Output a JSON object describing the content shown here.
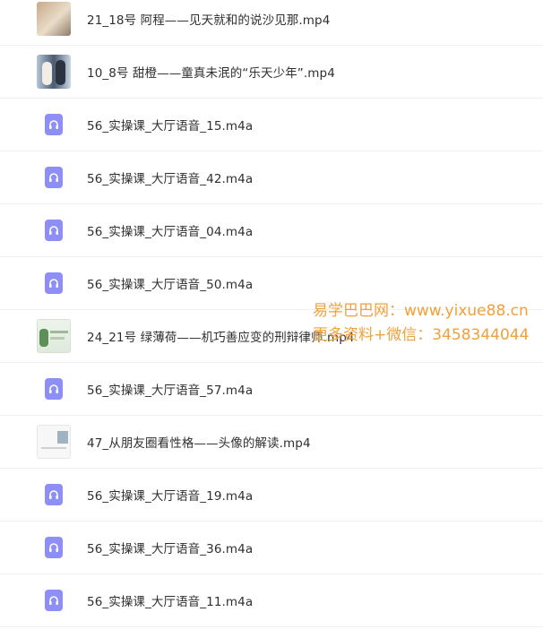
{
  "files": [
    {
      "name": "21_18号 阿程——见天就和的说沙见那.mp4",
      "kind": "video",
      "thumb": "a"
    },
    {
      "name": "10_8号 甜橙——童真未泯的“乐天少年”.mp4",
      "kind": "video",
      "thumb": "b"
    },
    {
      "name": "56_实操课_大厅语音_15.m4a",
      "kind": "audio"
    },
    {
      "name": "56_实操课_大厅语音_42.m4a",
      "kind": "audio"
    },
    {
      "name": "56_实操课_大厅语音_04.m4a",
      "kind": "audio"
    },
    {
      "name": "56_实操课_大厅语音_50.m4a",
      "kind": "audio"
    },
    {
      "name": "24_21号 绿薄荷——机巧善应变的刑辩律师.mp4",
      "kind": "video",
      "thumb": "c"
    },
    {
      "name": "56_实操课_大厅语音_57.m4a",
      "kind": "audio"
    },
    {
      "name": "47_从朋友圈看性格——头像的解读.mp4",
      "kind": "video",
      "thumb": "d"
    },
    {
      "name": "56_实操课_大厅语音_19.m4a",
      "kind": "audio"
    },
    {
      "name": "56_实操课_大厅语音_36.m4a",
      "kind": "audio"
    },
    {
      "name": "56_实操课_大厅语音_11.m4a",
      "kind": "audio"
    }
  ],
  "watermark": {
    "line1": "易学巴巴网：www.yixue88.cn",
    "line2": "更多资料+微信：3458344044"
  },
  "colors": {
    "audio_icon": "#8d8ef6",
    "watermark": "#f2a03a"
  }
}
